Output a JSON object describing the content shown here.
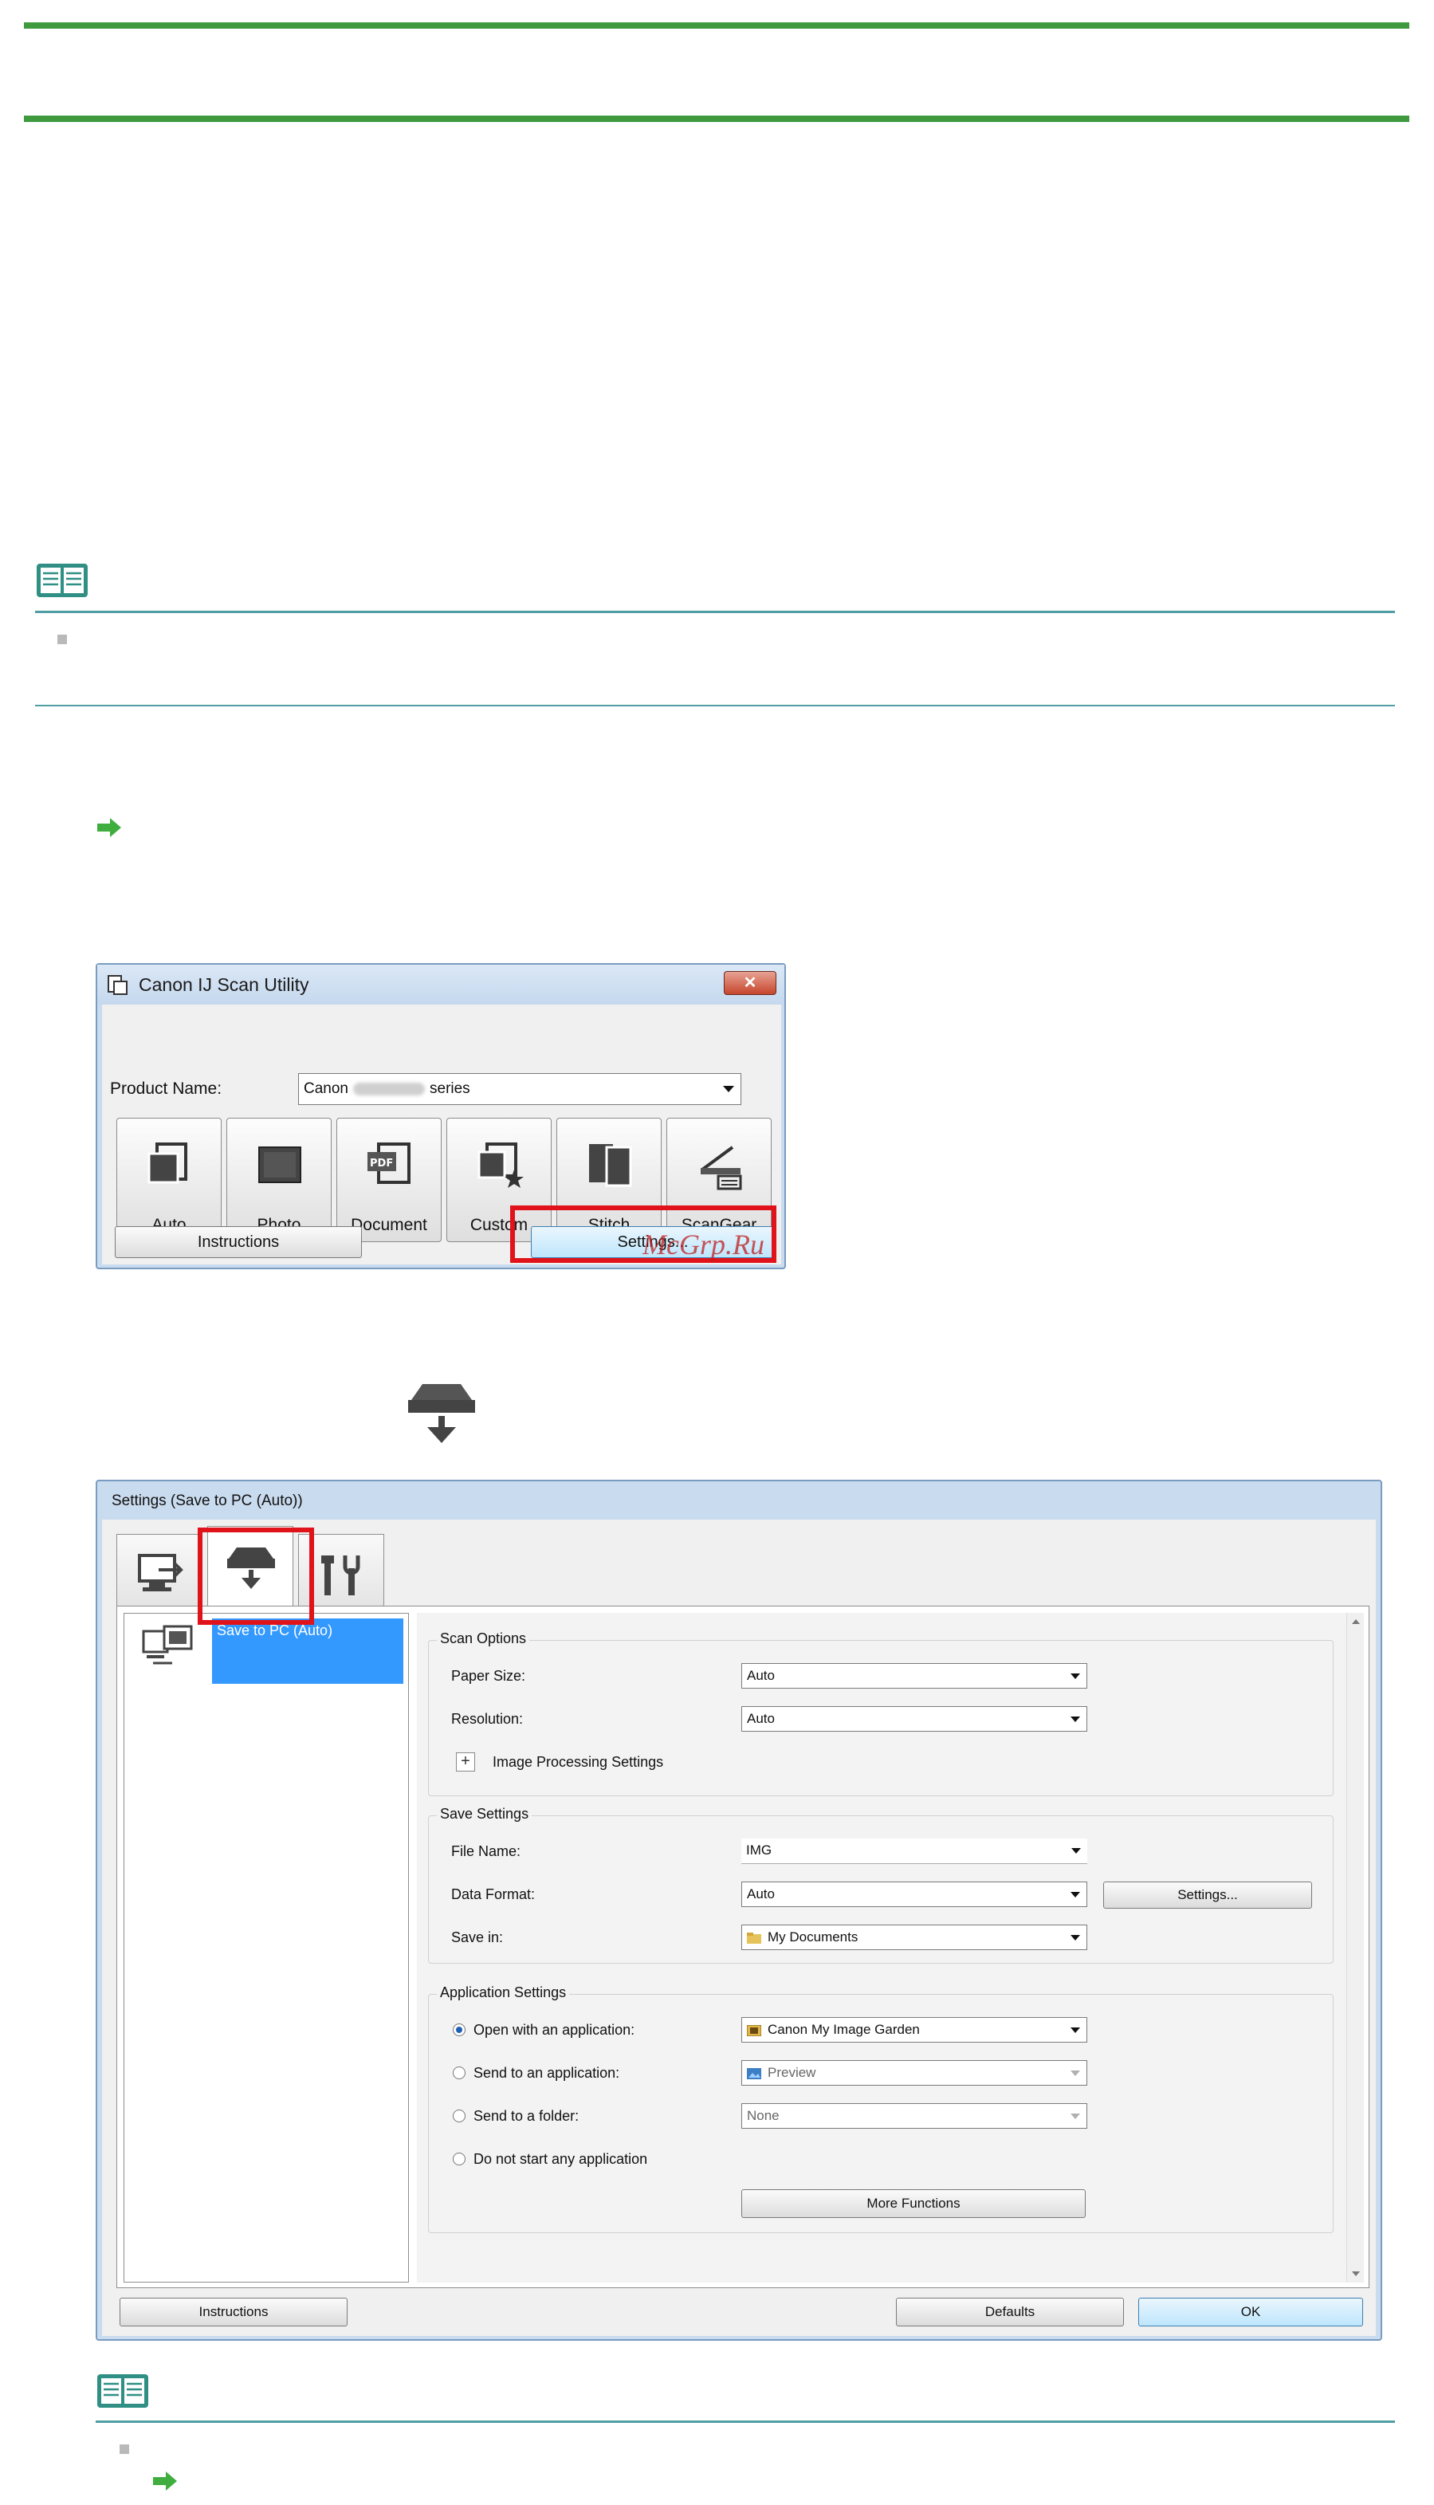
{
  "scan_utility": {
    "title": "Canon IJ Scan Utility",
    "close_label": "✕",
    "product_label": "Product Name:",
    "product_value_prefix": "Canon",
    "product_value_suffix": "series",
    "buttons": [
      "Auto",
      "Photo",
      "Document",
      "Custom",
      "Stitch",
      "ScanGear"
    ],
    "instructions_label": "Instructions",
    "settings_label": "Settings..."
  },
  "watermark": "McGrp.Ru",
  "settings_dialog": {
    "title": "Settings (Save to PC (Auto))",
    "tree_item": "Save to PC (Auto)",
    "scan_options": {
      "title": "Scan Options",
      "paper_size_label": "Paper Size:",
      "paper_size_value": "Auto",
      "resolution_label": "Resolution:",
      "resolution_value": "Auto",
      "image_processing_label": "Image Processing Settings"
    },
    "save_settings": {
      "title": "Save Settings",
      "file_name_label": "File Name:",
      "file_name_value": "IMG",
      "data_format_label": "Data Format:",
      "data_format_value": "Auto",
      "format_settings_label": "Settings...",
      "save_in_label": "Save in:",
      "save_in_value": "My Documents"
    },
    "application_settings": {
      "title": "Application Settings",
      "open_app_label": "Open with an application:",
      "open_app_value": "Canon My Image Garden",
      "send_app_label": "Send to an application:",
      "send_app_value": "Preview",
      "send_folder_label": "Send to a folder:",
      "send_folder_value": "None",
      "no_app_label": "Do not start any application",
      "more_functions_label": "More Functions"
    },
    "instructions_label": "Instructions",
    "defaults_label": "Defaults",
    "ok_label": "OK"
  },
  "colors": {
    "green_rule": "#3f9a3f",
    "teal_rule": "#4f9ea3",
    "highlight": "#e0131a",
    "selection": "#3399ff"
  }
}
